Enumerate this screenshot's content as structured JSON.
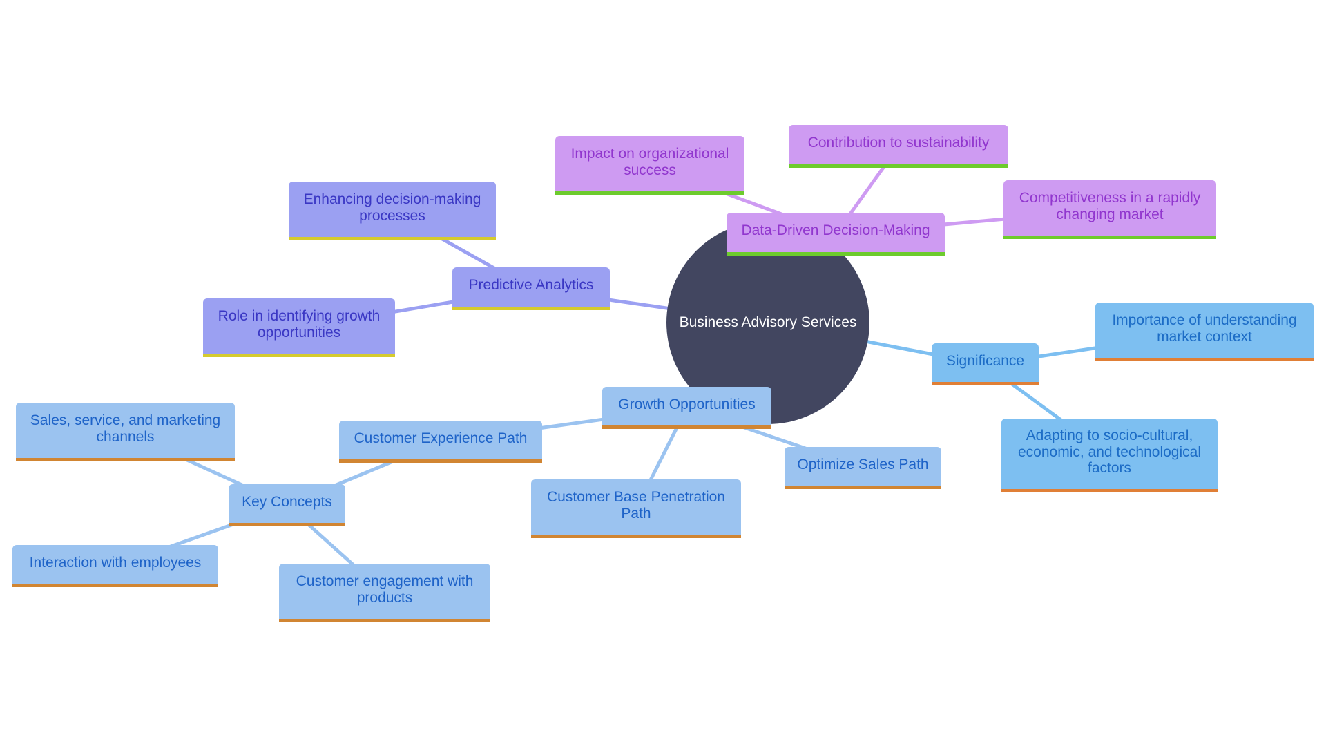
{
  "root": {
    "label": "Business Advisory Services",
    "color": "#424660"
  },
  "branches": [
    {
      "id": "ddm",
      "label": "Data-Driven Decision-Making",
      "theme": "purple",
      "children": [
        {
          "id": "impact",
          "label": "Impact on organizational success"
        },
        {
          "id": "contribution",
          "label": "Contribution to sustainability"
        },
        {
          "id": "competitiveness",
          "label": "Competitiveness in a rapidly changing market"
        }
      ]
    },
    {
      "id": "predictive",
      "label": "Predictive Analytics",
      "theme": "indigo",
      "children": [
        {
          "id": "enhancing",
          "label": "Enhancing decision-making processes"
        },
        {
          "id": "role",
          "label": "Role in identifying growth opportunities"
        }
      ]
    },
    {
      "id": "significance",
      "label": "Significance",
      "theme": "sky",
      "children": [
        {
          "id": "importance",
          "label": "Importance of understanding market context"
        },
        {
          "id": "adapting",
          "label": "Adapting to socio-cultural, economic, and technological factors"
        }
      ]
    },
    {
      "id": "growth",
      "label": "Growth Opportunities",
      "theme": "pale",
      "children": [
        {
          "id": "cx",
          "label": "Customer Experience Path",
          "children": [
            {
              "id": "key",
              "label": "Key Concepts",
              "children": [
                {
                  "id": "sales",
                  "label": "Sales, service, and marketing channels"
                },
                {
                  "id": "interaction",
                  "label": "Interaction with employees"
                },
                {
                  "id": "engagement",
                  "label": "Customer engagement with products"
                }
              ]
            }
          ]
        },
        {
          "id": "cbp",
          "label": "Customer Base Penetration Path"
        },
        {
          "id": "optimize",
          "label": "Optimize Sales Path"
        }
      ]
    }
  ],
  "theme_colors": {
    "purple": {
      "fill": "#CE9BF2",
      "text": "#9136CE",
      "accent": "#6DCB2D",
      "edge": "#CE9BF2"
    },
    "indigo": {
      "fill": "#9BA0F2",
      "text": "#3A37C4",
      "accent": "#D5CB2E",
      "edge": "#9BA0F2"
    },
    "sky": {
      "fill": "#7DBFF1",
      "text": "#1C6CC6",
      "accent": "#E07F36",
      "edge": "#7DBFF1"
    },
    "pale": {
      "fill": "#9BC3F0",
      "text": "#1E63C8",
      "accent": "#D18532",
      "edge": "#9BC3F0"
    }
  }
}
